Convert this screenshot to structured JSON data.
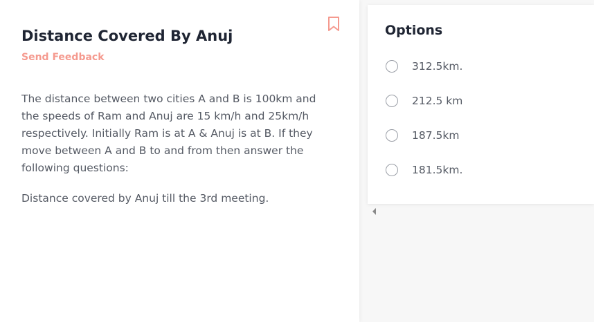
{
  "question": {
    "title": "Distance Covered By Anuj",
    "feedback_label": "Send Feedback",
    "bookmark_icon": "bookmark-icon",
    "body": "The distance between two cities A and B is 100km and the speeds of Ram and Anuj are 15 km/h and 25km/h respectively. Initially Ram is at A & Anuj is at B. If they move between A and B to and from then answer the following questions:",
    "prompt": "Distance covered by Anuj till the 3rd meeting."
  },
  "options": {
    "title": "Options",
    "items": [
      {
        "label": "312.5km."
      },
      {
        "label": "212.5 km"
      },
      {
        "label": "187.5km"
      },
      {
        "label": "181.5km."
      }
    ]
  },
  "colors": {
    "accent": "#f59a8f",
    "heading": "#1f2533",
    "body_text": "#555a64"
  }
}
